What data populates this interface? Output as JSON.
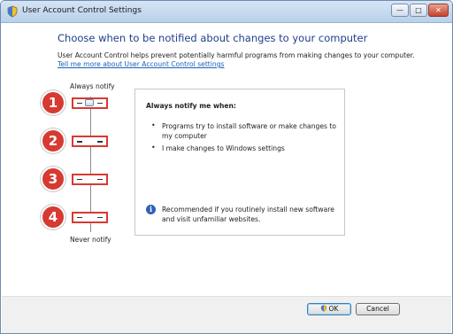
{
  "window": {
    "title": "User Account Control Settings",
    "controls": {
      "minimize": "—",
      "maximize": "□",
      "close": "✕"
    }
  },
  "main": {
    "heading": "Choose when to be notified about changes to your computer",
    "description": "User Account Control helps prevent potentially harmful programs from making changes to your computer.",
    "link": "Tell me more about User Account Control settings"
  },
  "slider": {
    "top_label": "Always notify",
    "bottom_label": "Never notify",
    "selected_level": 1,
    "markers": [
      "1",
      "2",
      "3",
      "4"
    ]
  },
  "panel": {
    "title": "Always notify me when:",
    "items": [
      "Programs try to install software or make changes to my computer",
      "I make changes to Windows settings"
    ],
    "info": "Recommended if you routinely install new software and visit unfamiliar websites."
  },
  "buttons": {
    "ok": "OK",
    "cancel": "Cancel"
  },
  "colors": {
    "heading": "#1e3f8a",
    "link": "#1c5fb8",
    "highlight_red": "#d63a32",
    "info_blue": "#2e62b8"
  }
}
